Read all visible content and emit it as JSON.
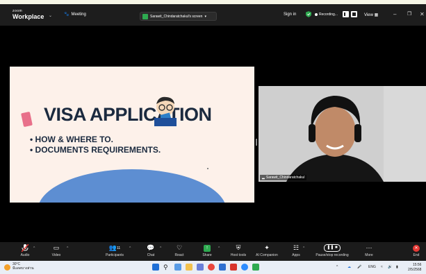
{
  "app": {
    "logo_top": "zoom",
    "logo_bottom": "Workplace"
  },
  "meeting": {
    "label": "Meeting"
  },
  "share": {
    "label": "Sarawit_Chindaratchakul's screen"
  },
  "top_right": {
    "sign_in": "Sign in",
    "recording": "Recording...",
    "view": "View"
  },
  "slide": {
    "title": "VISA APPLICATION",
    "bullets": [
      "• HOW & WHERE TO.",
      "• DOCUMENTS REQUIREMENTS."
    ]
  },
  "participant": {
    "name": "Sarawit_Chindaratchakul"
  },
  "toolbar": {
    "audio": "Audio",
    "video": "Video",
    "participants": "Participants",
    "participants_count": "11",
    "chat": "Chat",
    "react": "React",
    "share": "Share",
    "host_tools": "Host tools",
    "ai_companion": "AI Companion",
    "apps": "Apps",
    "pause_stop": "Pause/stop recording",
    "more": "More",
    "end": "End"
  },
  "taskbar": {
    "temp": "30°C",
    "weather": "มีแดดบางส่วน",
    "lang": "ENG",
    "time": "15:56",
    "date": "2/5/2568"
  },
  "colors": {
    "accent_green": "#2eaa50",
    "slide_bg": "#fdf1ea",
    "hill": "#5d8ed2",
    "text_navy": "#1b2a3f"
  }
}
